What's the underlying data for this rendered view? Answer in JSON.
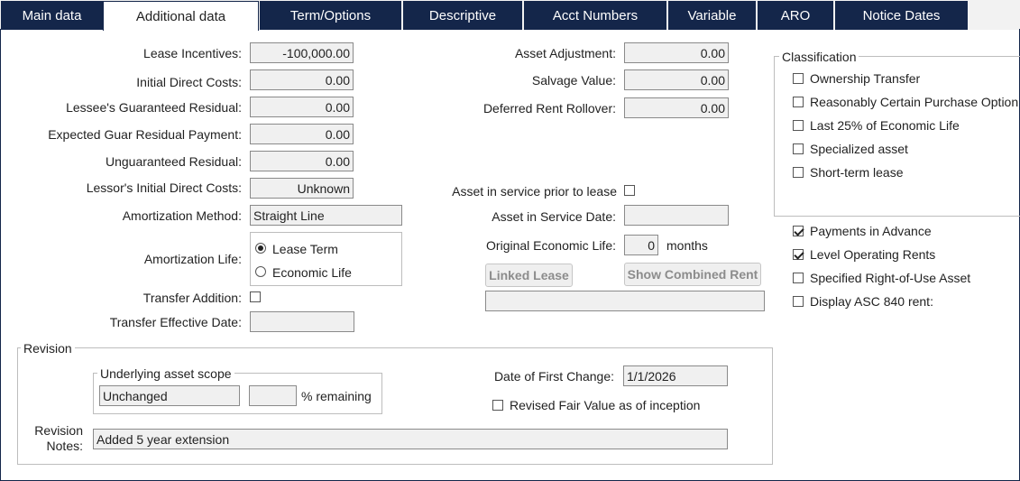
{
  "tabs": [
    "Main data",
    "Additional data",
    "Term/Options",
    "Descriptive",
    "Acct Numbers",
    "Variable",
    "ARO",
    "Notice Dates"
  ],
  "left": {
    "lease_incentives": {
      "label": "Lease Incentives:",
      "value": "-100,000.00"
    },
    "initial_direct_costs": {
      "label": "Initial Direct Costs:",
      "value": "0.00"
    },
    "lessee_guaranteed_residual": {
      "label": "Lessee's Guaranteed Residual:",
      "value": "0.00"
    },
    "expected_guar_residual_payment": {
      "label": "Expected Guar Residual Payment:",
      "value": "0.00"
    },
    "unguaranteed_residual": {
      "label": "Unguaranteed Residual:",
      "value": "0.00"
    },
    "lessor_initial_direct_costs": {
      "label": "Lessor's Initial Direct Costs:",
      "value": "Unknown"
    },
    "amortization_method": {
      "label": "Amortization Method:",
      "value": "Straight Line"
    },
    "amortization_life": {
      "label": "Amortization Life:",
      "options": [
        "Lease Term",
        "Economic Life"
      ],
      "selected": "Lease Term"
    },
    "transfer_addition": {
      "label": "Transfer Addition:"
    },
    "transfer_effective_date": {
      "label": "Transfer Effective Date:",
      "value": ""
    }
  },
  "middle": {
    "asset_adjustment": {
      "label": "Asset Adjustment:",
      "value": "0.00"
    },
    "salvage_value": {
      "label": "Salvage Value:",
      "value": "0.00"
    },
    "deferred_rent_rollover": {
      "label": "Deferred Rent Rollover:",
      "value": "0.00"
    },
    "asset_in_service_prior": {
      "label": "Asset in service prior to lease"
    },
    "asset_in_service_date": {
      "label": "Asset in Service Date:",
      "value": ""
    },
    "original_economic_life": {
      "label": "Original Economic Life:",
      "value": "0",
      "unit": "months"
    },
    "linked_lease_button": "Linked Lease",
    "show_combined_rent_button": "Show Combined Rent",
    "linked_lease_field": ""
  },
  "classification": {
    "title": "Classification",
    "items": [
      "Ownership Transfer",
      "Reasonably Certain Purchase Option",
      "Last 25% of Economic Life",
      "Specialized asset",
      "Short-term lease"
    ]
  },
  "options": {
    "items": [
      {
        "label": "Payments in Advance",
        "checked": true
      },
      {
        "label": "Level Operating Rents",
        "checked": true
      },
      {
        "label": "Specified Right-of-Use Asset",
        "checked": false
      },
      {
        "label": "Display ASC 840 rent:",
        "checked": false
      }
    ]
  },
  "revision": {
    "title": "Revision",
    "scope_title": "Underlying asset scope",
    "scope_value": "Unchanged",
    "percent_value": "",
    "percent_unit": "% remaining",
    "date_first_change": {
      "label": "Date of First Change:",
      "value": "1/1/2026"
    },
    "revised_fair_value": {
      "label": "Revised Fair Value as of inception"
    },
    "notes_label_1": "Revision",
    "notes_label_2": "Notes:",
    "notes_value": "Added 5 year extension"
  }
}
